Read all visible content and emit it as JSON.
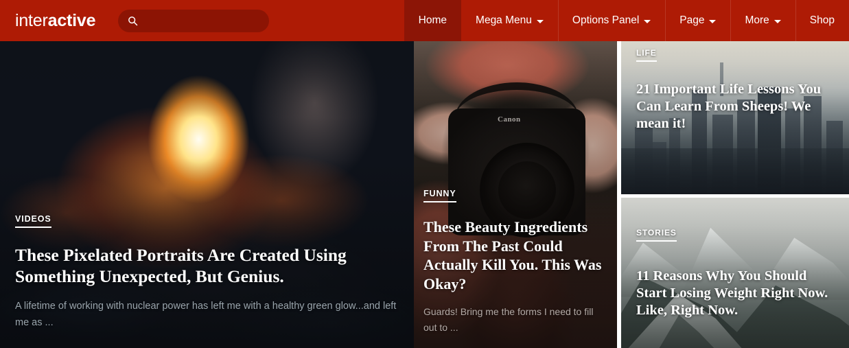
{
  "site": {
    "brand_light": "inter",
    "brand_bold": "active"
  },
  "search": {
    "icon": "search-icon",
    "value": "",
    "placeholder": ""
  },
  "nav": {
    "items": [
      {
        "label": "Home",
        "has_caret": false,
        "active": true
      },
      {
        "label": "Mega Menu",
        "has_caret": true,
        "active": false
      },
      {
        "label": "Options Panel",
        "has_caret": true,
        "active": false
      },
      {
        "label": "Page",
        "has_caret": true,
        "active": false
      },
      {
        "label": "More",
        "has_caret": true,
        "active": false
      },
      {
        "label": "Shop",
        "has_caret": false,
        "active": false
      }
    ]
  },
  "colors": {
    "header_red": "#ae1b05",
    "header_red_active": "#8c1506",
    "search_field": "#8c1404",
    "text_on_dark": "#ffffff",
    "excerpt_muted": "#9aa5ad"
  },
  "cards": {
    "main": {
      "category": "VIDEOS",
      "headline": "These Pixelated Portraits Are Created Using Something Unexpected, But Genius.",
      "excerpt": "A lifetime of working with nuclear power has left me with a healthy green glow...and left me as ...",
      "image": "bonfire-embers-photo"
    },
    "camera": {
      "category": "FUNNY",
      "headline": "These Beauty Ingredients From The Past Could Actually Kill You. This Was Okay?",
      "excerpt": "Guards! Bring me the forms I need to fill out to ...",
      "image": "hands-holding-canon-dslr-photo",
      "camera_brand_text": "Canon"
    },
    "city": {
      "category": "LIFE",
      "headline": "21 Important Life Lessons You Can Learn From Sheeps! We mean it!",
      "excerpt": "",
      "image": "city-skyline-photo"
    },
    "mountain": {
      "category": "STORIES",
      "headline": "11 Reasons Why You Should Start Losing Weight Right Now. Like, Right Now.",
      "excerpt": "",
      "image": "snowy-mountains-photo"
    }
  }
}
